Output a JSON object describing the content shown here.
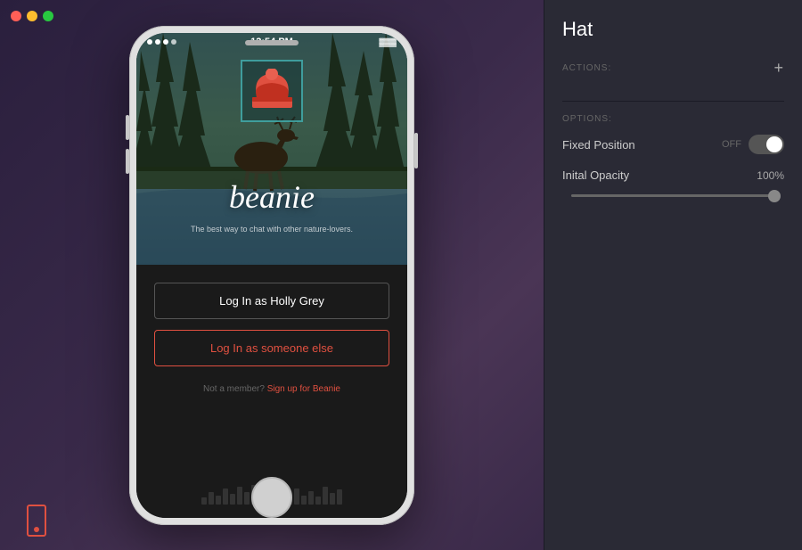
{
  "window": {
    "controls": {
      "close": "close",
      "minimize": "minimize",
      "maximize": "maximize"
    }
  },
  "phone": {
    "status_bar": {
      "time": "12:54 PM",
      "dots": [
        "filled",
        "filled",
        "filled",
        "empty"
      ]
    },
    "app": {
      "title": "beanie",
      "subtitle": "The best way to chat with other nature-lovers.",
      "btn_login_primary": "Log In as Holly Grey",
      "btn_login_secondary": "Log In as someone else",
      "not_member_text": "Not a member?",
      "signup_text": "Sign up for Beanie"
    }
  },
  "right_panel": {
    "title": "Hat",
    "actions_label": "ACTIONS:",
    "options_label": "OPTIONS:",
    "options": {
      "fixed_position": {
        "label": "Fixed Position",
        "toggle_off_label": "OFF",
        "state": "off"
      },
      "initial_opacity": {
        "label": "Inital Opacity",
        "value": "100%",
        "slider_percent": 100
      }
    },
    "add_icon": "+"
  }
}
